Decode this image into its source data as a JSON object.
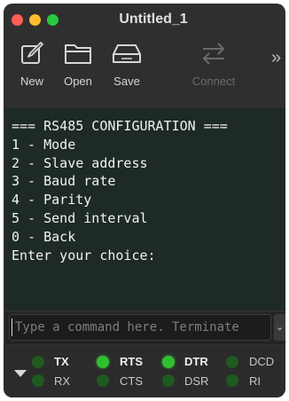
{
  "window": {
    "title": "Untitled_1",
    "traffic_lights": {
      "close": "#fe5f57",
      "minimize": "#febc2e",
      "zoom": "#28c840"
    }
  },
  "toolbar": {
    "new_label": "New",
    "open_label": "Open",
    "save_label": "Save",
    "connect_label": "Connect",
    "more_icon": "chevron-double-right",
    "overflow_glyph": "»"
  },
  "terminal": {
    "background": "#1e2a24",
    "lines": [
      "=== RS485 CONFIGURATION ===",
      "1 - Mode",
      "2 - Slave address",
      "3 - Baud rate",
      "4 - Parity",
      "5 - Send interval",
      "0 - Back",
      "Enter your choice:"
    ]
  },
  "command": {
    "placeholder": "Type a command here. Terminate",
    "value": "",
    "send_glyph": "⌄"
  },
  "status": {
    "led_on_color": "#2fbf2f",
    "led_off_color": "#1f5a1f",
    "signals": [
      {
        "name": "TX",
        "on": false,
        "bright": true
      },
      {
        "name": "RX",
        "on": false,
        "bright": false
      },
      {
        "name": "RTS",
        "on": true,
        "bright": true
      },
      {
        "name": "CTS",
        "on": false,
        "bright": false
      },
      {
        "name": "DTR",
        "on": true,
        "bright": true
      },
      {
        "name": "DSR",
        "on": false,
        "bright": false
      },
      {
        "name": "DCD",
        "on": false,
        "bright": false
      },
      {
        "name": "RI",
        "on": false,
        "bright": false
      }
    ]
  }
}
